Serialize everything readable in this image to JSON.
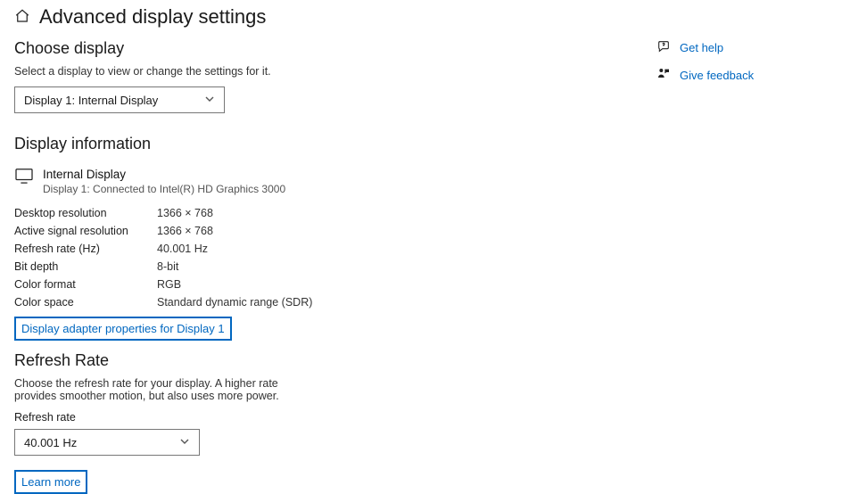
{
  "header": {
    "title": "Advanced display settings"
  },
  "choose": {
    "heading": "Choose display",
    "helper": "Select a display to view or change the settings for it.",
    "selected": "Display 1: Internal Display"
  },
  "info": {
    "heading": "Display information",
    "display_name": "Internal Display",
    "display_sub": "Display 1: Connected to Intel(R) HD Graphics 3000",
    "rows": [
      {
        "k": "Desktop resolution",
        "v": "1366 × 768"
      },
      {
        "k": "Active signal resolution",
        "v": "1366 × 768"
      },
      {
        "k": "Refresh rate (Hz)",
        "v": "40.001 Hz"
      },
      {
        "k": "Bit depth",
        "v": "8-bit"
      },
      {
        "k": "Color format",
        "v": "RGB"
      },
      {
        "k": "Color space",
        "v": "Standard dynamic range (SDR)"
      }
    ],
    "adapter_link": "Display adapter properties for Display 1"
  },
  "refresh": {
    "heading": "Refresh Rate",
    "helper": "Choose the refresh rate for your display. A higher rate provides smoother motion, but also uses more power.",
    "label": "Refresh rate",
    "selected": "40.001 Hz",
    "learn_more": "Learn more"
  },
  "side": {
    "help": "Get help",
    "feedback": "Give feedback"
  }
}
